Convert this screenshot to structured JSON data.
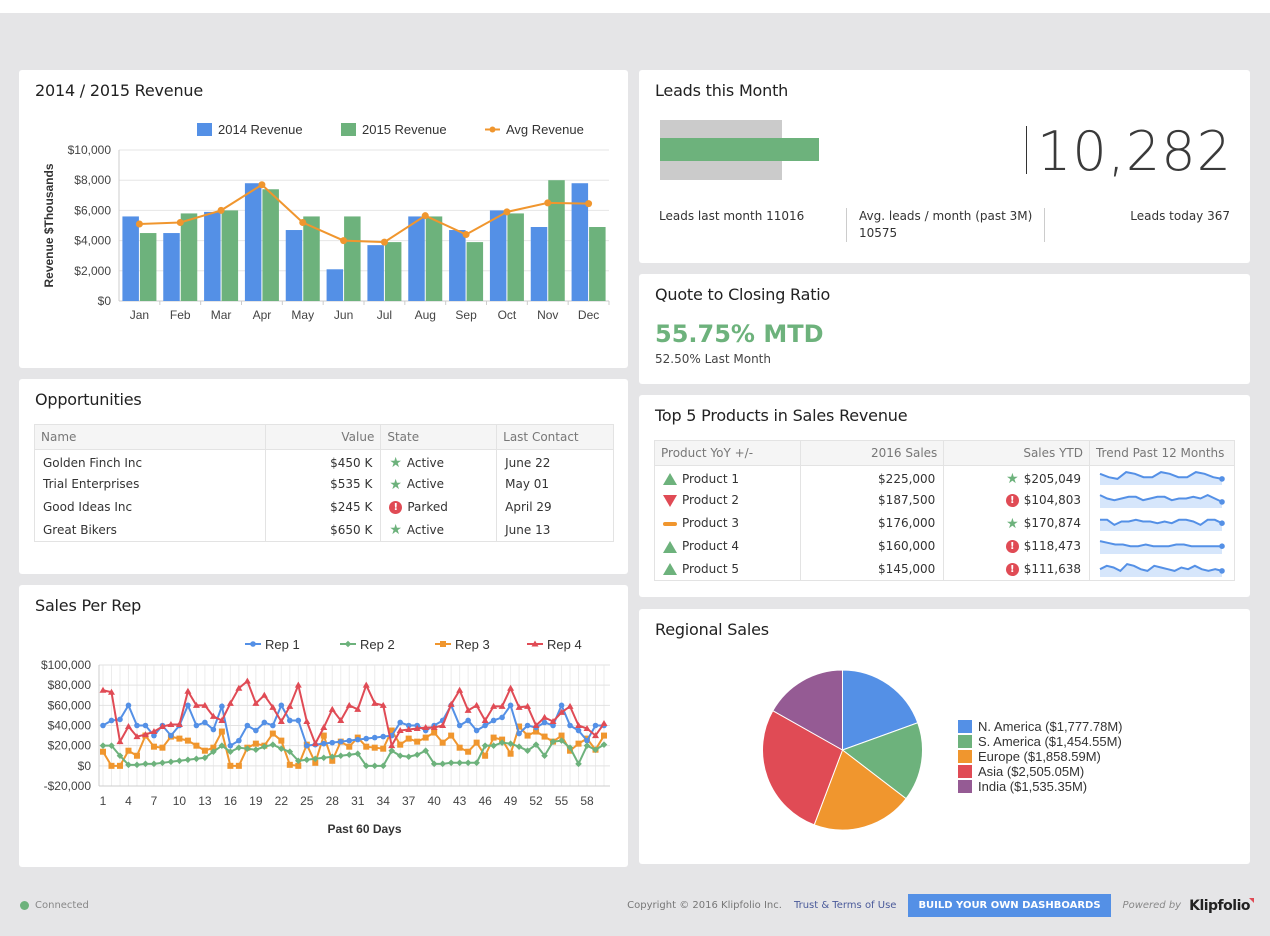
{
  "colors": {
    "blue": "#5490e6",
    "green": "#6db27c",
    "orange": "#f0962e",
    "red": "#e04b55",
    "purple": "#955b94",
    "gray_bar": "#cbcbcb"
  },
  "revenue": {
    "title": "2014 / 2015 Revenue",
    "chart_data": {
      "type": "bar",
      "title": "2014 / 2015 Revenue",
      "xlabel": "",
      "ylabel": "Revenue $Thousands",
      "ylim": [
        0,
        10000
      ],
      "yticks": [
        "$0",
        "$2,000",
        "$4,000",
        "$6,000",
        "$8,000",
        "$10,000"
      ],
      "ytick_values": [
        0,
        2000,
        4000,
        6000,
        8000,
        10000
      ],
      "categories": [
        "Jan",
        "Feb",
        "Mar",
        "Apr",
        "May",
        "Jun",
        "Jul",
        "Aug",
        "Sep",
        "Oct",
        "Nov",
        "Dec"
      ],
      "legend_position": "top",
      "grid": true,
      "series": [
        {
          "name": "2014 Revenue",
          "type": "bar",
          "color": "#5490e6",
          "values": [
            5600,
            4500,
            5900,
            7800,
            4700,
            2100,
            3700,
            5600,
            4700,
            6000,
            4900,
            7800
          ]
        },
        {
          "name": "2015 Revenue",
          "type": "bar",
          "color": "#6db27c",
          "values": [
            4500,
            5800,
            6000,
            7400,
            5600,
            5600,
            3900,
            5600,
            3900,
            5800,
            8000,
            4900
          ]
        },
        {
          "name": "Avg Revenue",
          "type": "line",
          "color": "#f0962e",
          "values": [
            5100,
            5200,
            6000,
            7700,
            5200,
            4000,
            3900,
            5650,
            4400,
            5900,
            6500,
            6450
          ]
        }
      ]
    }
  },
  "leads": {
    "title": "Leads this Month",
    "value": "10,282",
    "last_month": "Leads last month 11016",
    "avg_label": "Avg. leads / month (past 3M)",
    "avg_value": "10575",
    "today": "Leads today 367",
    "bar_current": 10282,
    "bar_target": 11016
  },
  "quote": {
    "title": "Quote to Closing Ratio",
    "value": "55.75% MTD",
    "last_month": "52.50% Last Month"
  },
  "opportunities": {
    "title": "Opportunities",
    "columns": [
      "Name",
      "Value",
      "State",
      "Last Contact"
    ],
    "rows": [
      {
        "name": "Golden Finch Inc",
        "value": "$450 K",
        "state": "Active",
        "state_icon": "star-icon",
        "last_contact": "June 22",
        "overdue": false
      },
      {
        "name": "Trial Enterprises",
        "value": "$535 K",
        "state": "Active",
        "state_icon": "star-icon",
        "last_contact": "May 01",
        "overdue": false
      },
      {
        "name": "Good Ideas Inc",
        "value": "$245 K",
        "state": "Parked",
        "state_icon": "alert-icon",
        "last_contact": "April 29",
        "overdue": true
      },
      {
        "name": "Great Bikers",
        "value": "$650 K",
        "state": "Active",
        "state_icon": "star-icon",
        "last_contact": "June 13",
        "overdue": false
      }
    ]
  },
  "products": {
    "title": "Top 5 Products in Sales Revenue",
    "columns": [
      "Product YoY +/-",
      "2016 Sales",
      "Sales YTD",
      "Trend Past 12 Months"
    ],
    "rows": [
      {
        "trend_icon": "triangle-up-icon",
        "name": "Product 1",
        "sales_2016": "$225,000",
        "ytd_icon": "star-icon",
        "ytd": "$205,049",
        "spark": [
          6,
          4,
          3,
          7,
          6,
          4,
          4,
          7,
          6,
          4,
          4,
          7,
          6,
          4,
          3
        ]
      },
      {
        "trend_icon": "triangle-down-icon",
        "name": "Product 2",
        "sales_2016": "$187,500",
        "ytd_icon": "alert-icon",
        "ytd": "$104,803",
        "spark": [
          7,
          5,
          4,
          5,
          6,
          6,
          4,
          5,
          6,
          6,
          4,
          5,
          5,
          6,
          5,
          7,
          5,
          3
        ]
      },
      {
        "trend_icon": "dash-icon",
        "name": "Product 3",
        "sales_2016": "$176,000",
        "ytd_icon": "star-icon",
        "ytd": "$170,874",
        "spark": [
          6,
          6,
          3,
          5,
          5,
          6,
          5,
          5,
          4,
          5,
          4,
          6,
          6,
          5,
          3,
          6,
          6,
          4
        ]
      },
      {
        "trend_icon": "triangle-up-icon",
        "name": "Product 4",
        "sales_2016": "$160,000",
        "ytd_icon": "alert-icon",
        "ytd": "$118,473",
        "spark": [
          7,
          6,
          5,
          5,
          4,
          4,
          5,
          4,
          4,
          4,
          5,
          5,
          4,
          4,
          4,
          4,
          4
        ]
      },
      {
        "trend_icon": "triangle-up-icon",
        "name": "Product 5",
        "sales_2016": "$145,000",
        "ytd_icon": "alert-icon",
        "ytd": "$111,638",
        "spark": [
          4,
          6,
          5,
          3,
          7,
          6,
          4,
          3,
          6,
          5,
          4,
          3,
          5,
          4,
          6,
          4,
          3,
          4,
          3
        ]
      }
    ]
  },
  "sales_per_rep": {
    "title": "Sales Per Rep",
    "chart_data": {
      "type": "line",
      "title": "Sales Per Rep",
      "xlabel": "Past 60 Days",
      "ylabel": "",
      "ylim": [
        -20000,
        100000
      ],
      "yticks": [
        "-$20,000",
        "$0",
        "$20,000",
        "$40,000",
        "$60,000",
        "$80,000",
        "$100,000"
      ],
      "ytick_values": [
        -20000,
        0,
        20000,
        40000,
        60000,
        80000,
        100000
      ],
      "xticks": [
        "1",
        "4",
        "7",
        "10",
        "13",
        "16",
        "19",
        "22",
        "25",
        "28",
        "31",
        "34",
        "37",
        "40",
        "43",
        "46",
        "49",
        "52",
        "55",
        "58"
      ],
      "xtick_values": [
        1,
        4,
        7,
        10,
        13,
        16,
        19,
        22,
        25,
        28,
        31,
        34,
        37,
        40,
        43,
        46,
        49,
        52,
        55,
        58
      ],
      "x_range": [
        1,
        60
      ],
      "legend_position": "top",
      "grid": true,
      "series": [
        {
          "name": "Rep 1",
          "color": "#5490e6",
          "marker": "circle",
          "values": [
            40000,
            45000,
            46000,
            60000,
            40000,
            40000,
            30000,
            40000,
            30000,
            40000,
            60000,
            40000,
            43000,
            36000,
            59000,
            20000,
            25000,
            40000,
            35000,
            43000,
            40000,
            60000,
            45000,
            45000,
            20000,
            21000,
            22000,
            23000,
            24000,
            25000,
            26000,
            27000,
            28000,
            29000,
            30000,
            43000,
            40000,
            40000,
            35000,
            40000,
            45000,
            60000,
            40000,
            45000,
            35000,
            40000,
            45000,
            48000,
            60000,
            32000,
            40000,
            38000,
            43000,
            40000,
            60000,
            40000,
            35000,
            25000,
            40000,
            40000
          ]
        },
        {
          "name": "Rep 2",
          "color": "#6db27c",
          "marker": "diamond",
          "values": [
            20000,
            20000,
            10000,
            1000,
            1000,
            2000,
            2000,
            3000,
            4000,
            5000,
            6000,
            7000,
            8000,
            14000,
            20000,
            14000,
            18000,
            17000,
            16000,
            19000,
            21000,
            17000,
            14000,
            5000,
            6000,
            7000,
            8000,
            9000,
            10000,
            11000,
            12000,
            0,
            0,
            0,
            15000,
            10000,
            9000,
            11000,
            15000,
            2000,
            2000,
            3000,
            3000,
            3000,
            3000,
            20000,
            20000,
            23000,
            22000,
            19000,
            15000,
            21000,
            10000,
            24000,
            25000,
            18000,
            2000,
            20000,
            16000,
            21000
          ]
        },
        {
          "name": "Rep 3",
          "color": "#f0962e",
          "marker": "square",
          "values": [
            14000,
            0,
            0,
            15000,
            10000,
            30000,
            19000,
            18000,
            29000,
            27000,
            25000,
            20000,
            15000,
            18000,
            34000,
            0,
            0,
            18000,
            22000,
            20000,
            32000,
            25000,
            1000,
            0,
            21000,
            3000,
            30000,
            5000,
            24000,
            19000,
            28000,
            19000,
            18000,
            17000,
            35000,
            21000,
            27000,
            24000,
            28000,
            33000,
            23000,
            30000,
            18000,
            14000,
            23000,
            10000,
            28000,
            26000,
            12000,
            39000,
            30000,
            34000,
            29000,
            24000,
            30000,
            15000,
            22000,
            27000,
            16000,
            30000
          ]
        },
        {
          "name": "Rep 4",
          "color": "#e04b55",
          "marker": "triangle",
          "values": [
            75000,
            73000,
            24000,
            39000,
            29000,
            31000,
            34000,
            39000,
            41000,
            41000,
            74000,
            60000,
            60000,
            49000,
            45000,
            62000,
            77000,
            84000,
            62000,
            70000,
            58000,
            44000,
            59000,
            80000,
            44000,
            22000,
            38000,
            56000,
            45000,
            60000,
            56000,
            80000,
            62000,
            60000,
            20000,
            35000,
            36000,
            37000,
            38000,
            38000,
            40000,
            61000,
            75000,
            55000,
            60000,
            45000,
            59000,
            59000,
            77000,
            58000,
            59000,
            40000,
            48000,
            44000,
            53000,
            59000,
            40000,
            37000,
            30000,
            42000
          ]
        }
      ]
    }
  },
  "regional": {
    "title": "Regional Sales",
    "chart_data": {
      "type": "pie",
      "title": "Regional Sales",
      "legend_position": "right",
      "slices": [
        {
          "label": "N. America ($1,777.78M)",
          "name": "N. America",
          "value": 1777.78,
          "color": "#5490e6"
        },
        {
          "label": "S. America ($1,454.55M)",
          "name": "S. America",
          "value": 1454.55,
          "color": "#6db27c"
        },
        {
          "label": "Europe ($1,858.59M)",
          "name": "Europe",
          "value": 1858.59,
          "color": "#f0962e"
        },
        {
          "label": "Asia ($2,505.05M)",
          "name": "Asia",
          "value": 2505.05,
          "color": "#e04b55"
        },
        {
          "label": "India ($1,535.35M)",
          "name": "India",
          "value": 1535.35,
          "color": "#955b94"
        }
      ]
    }
  },
  "footer": {
    "status": "Connected",
    "copyright": "Copyright © 2016 Klipfolio Inc.",
    "terms": "Trust & Terms of Use",
    "build_button": "BUILD YOUR OWN DASHBOARDS",
    "powered_by": "Powered by",
    "brand": "Klipfolio"
  }
}
